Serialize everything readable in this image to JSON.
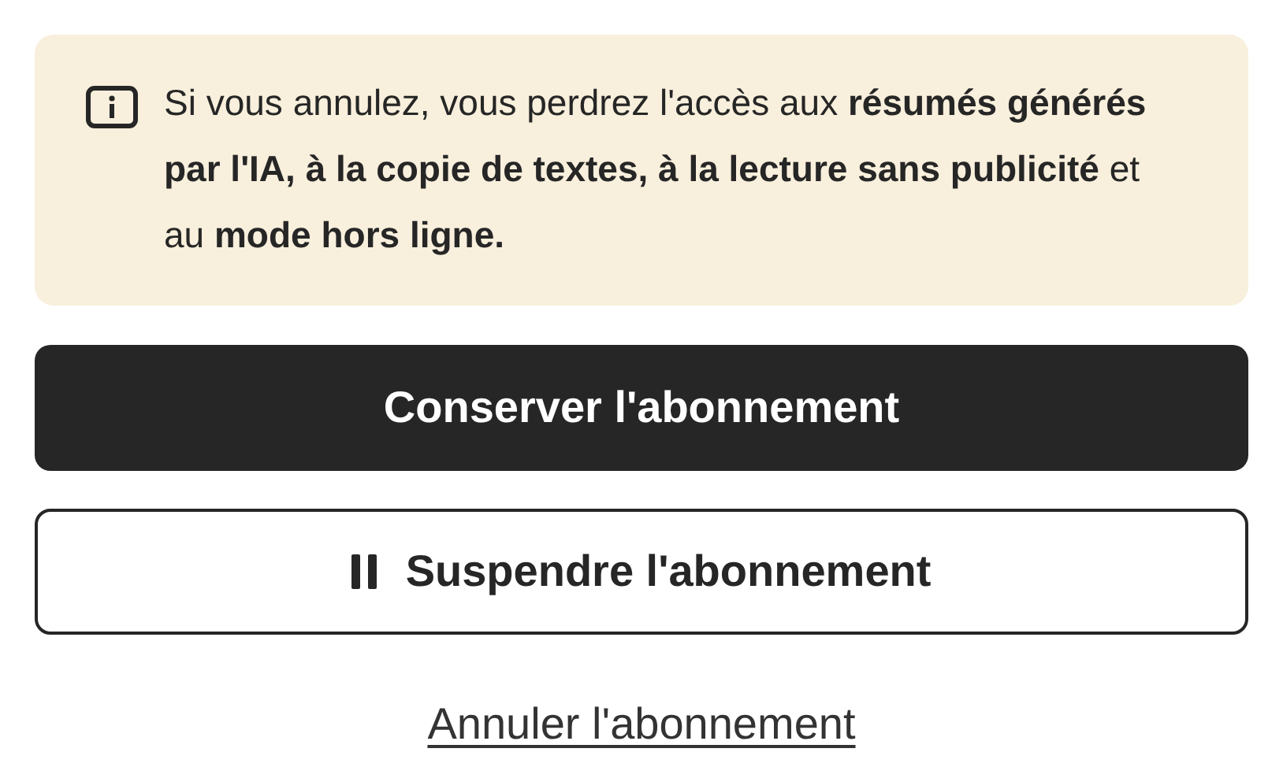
{
  "notice": {
    "text": "Si vous annulez, vous perdrez l'accès aux **résumés générés par l'IA, à la copie de textes, à la lecture sans publicité** et au **mode hors ligne.**"
  },
  "actions": [
    {
      "kind": "primary",
      "label": "Conserver l'abonnement"
    },
    {
      "kind": "secondary",
      "label": "Suspendre l'abonnement"
    },
    {
      "kind": "link",
      "label": "Annuler l'abonnement"
    }
  ]
}
